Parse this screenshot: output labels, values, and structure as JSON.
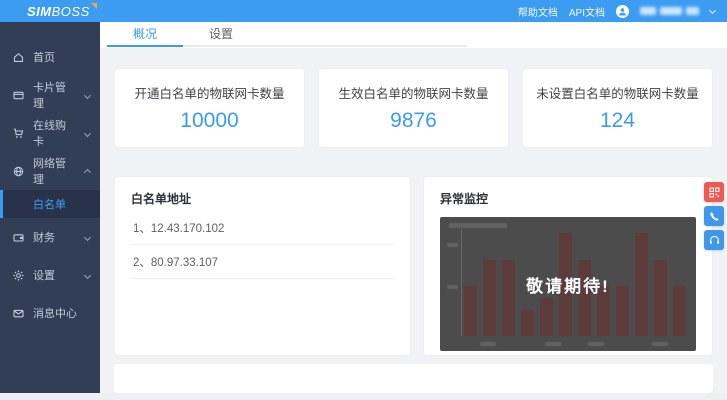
{
  "brand": {
    "name_bold": "SIM",
    "name_light": "BOSS"
  },
  "header": {
    "links": [
      {
        "label": "帮助文档"
      },
      {
        "label": "API文档"
      }
    ],
    "user": {
      "phone_redacted": true
    }
  },
  "tabs": [
    {
      "label": "概况",
      "active": true
    },
    {
      "label": "设置",
      "active": false
    }
  ],
  "sidebar": {
    "items": [
      {
        "label": "首页",
        "icon": "home-icon",
        "expandable": false
      },
      {
        "label": "卡片管理",
        "icon": "card-icon",
        "expandable": true
      },
      {
        "label": "在线购卡",
        "icon": "cart-icon",
        "expandable": true
      },
      {
        "label": "网络管理",
        "icon": "network-icon",
        "expandable": true,
        "expanded": true
      },
      {
        "label": "财务",
        "icon": "wallet-icon",
        "expandable": true
      },
      {
        "label": "设置",
        "icon": "gear-icon",
        "expandable": true
      },
      {
        "label": "消息中心",
        "icon": "message-icon",
        "expandable": false
      }
    ],
    "submenu": {
      "label": "白名单",
      "active": true
    }
  },
  "stats": [
    {
      "title": "开通白名单的物联网卡数量",
      "value": "10000"
    },
    {
      "title": "生效白名单的物联网卡数量",
      "value": "9876"
    },
    {
      "title": "未设置白名单的物联网卡数量",
      "value": "124"
    }
  ],
  "whitelist_panel": {
    "title": "白名单地址",
    "items": [
      "1、12.43.170.102",
      "2、80.97.33.107"
    ]
  },
  "monitor_panel": {
    "title": "异常监控",
    "overlay_text": "敬请期待!"
  },
  "chart_data": {
    "type": "bar",
    "title": "异常监控",
    "overlay_text": "敬请期待!",
    "bar_heights_pct": [
      48,
      72,
      72,
      25,
      36,
      98,
      72,
      48,
      48,
      98,
      72,
      48
    ],
    "x_tick_labels_legible": false,
    "y_tick_labels_legible": false,
    "legend": "none",
    "colors": {
      "bar": "#5e3b3b",
      "background": "#4c4c4c"
    }
  },
  "float_buttons": [
    {
      "name": "qrcode",
      "color": "#ec5b52"
    },
    {
      "name": "phone",
      "color": "#3e97ea"
    },
    {
      "name": "headset",
      "color": "#3e97ea"
    }
  ],
  "colors": {
    "primary": "#3a9cf0",
    "header": "#3b9cf1",
    "sidebar": "#323e55",
    "content_bg": "#f0f2f5"
  }
}
